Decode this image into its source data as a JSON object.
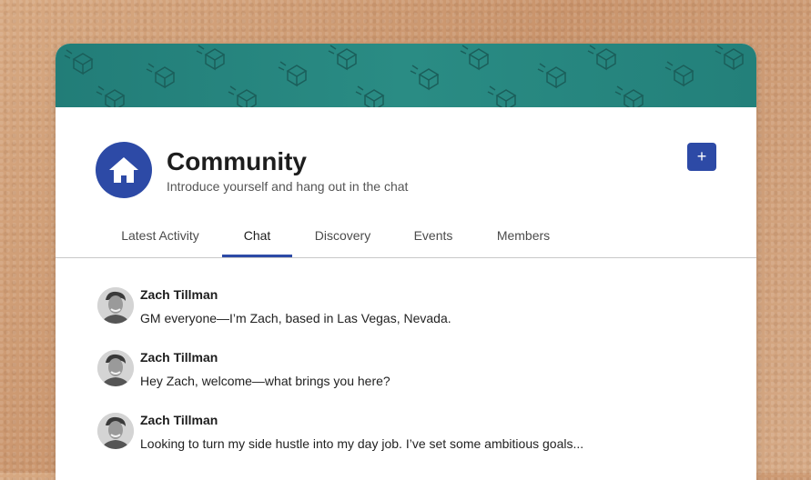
{
  "community": {
    "title": "Community",
    "subtitle": "Introduce yourself and hang out in the chat",
    "add_label": "+"
  },
  "tabs": [
    {
      "label": "Latest Activity",
      "active": false
    },
    {
      "label": "Chat",
      "active": true
    },
    {
      "label": "Discovery",
      "active": false
    },
    {
      "label": "Events",
      "active": false
    },
    {
      "label": "Members",
      "active": false
    }
  ],
  "messages": [
    {
      "author": "Zach Tillman",
      "text": "GM everyone—I’m Zach, based in Las Vegas, Nevada."
    },
    {
      "author": "Zach Tillman",
      "text": "Hey Zach, welcome—what brings you here?"
    },
    {
      "author": "Zach Tillman",
      "text": "Looking to turn my side hustle into my day job. I’ve set some ambitious goals..."
    }
  ],
  "icons": {
    "community_avatar": "home-icon",
    "add_button": "plus-icon"
  },
  "colors": {
    "accent": "#2d4aa6",
    "banner": "#2a8c84",
    "background": "#d1a07a"
  }
}
